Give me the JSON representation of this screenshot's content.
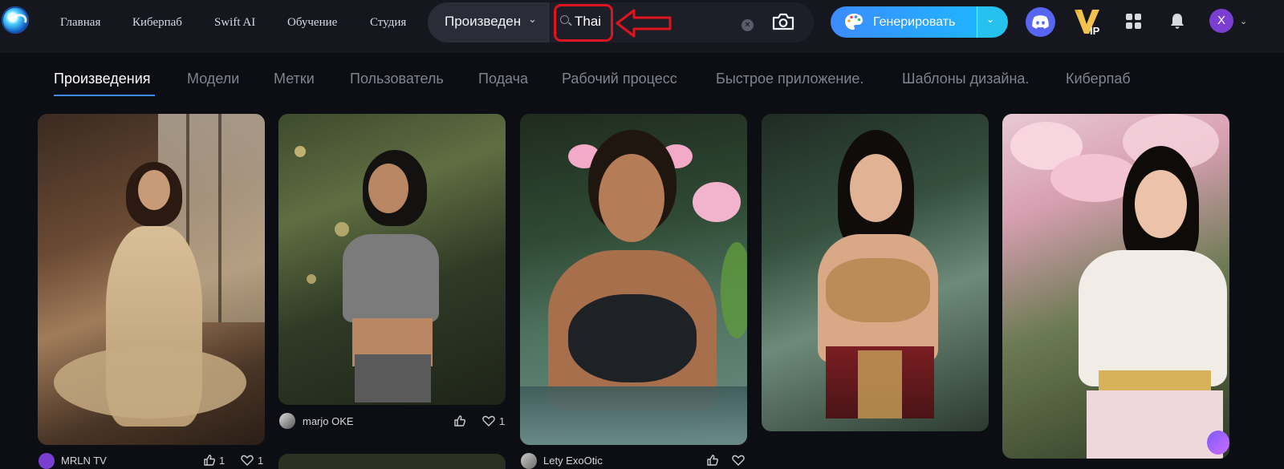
{
  "header": {
    "nav": [
      "Главная",
      "Киберпаб",
      "Swift AI",
      "Обучение",
      "Студия"
    ],
    "search": {
      "type_label": "Произведен",
      "value": "Thai"
    },
    "generate_label": "Генерировать",
    "avatar_letter": "X",
    "vip_label": "IP"
  },
  "tabs": [
    "Произведения",
    "Модели",
    "Метки",
    "Пользователь",
    "Подача",
    "Рабочий процесс",
    "Быстрое приложение.",
    "Шаблоны дизайна.",
    "Киберпаб"
  ],
  "gallery": [
    {
      "author": "MRLN TV",
      "likes": "1",
      "favorites": "1"
    },
    {
      "author": "marjo OKE",
      "likes": "",
      "favorites": "1"
    },
    {
      "author": "Lety ExoOtic",
      "likes": "",
      "favorites": ""
    },
    {
      "author": "",
      "likes": "",
      "favorites": ""
    },
    {
      "author": "",
      "likes": "",
      "favorites": ""
    }
  ],
  "colors": {
    "background": "#0d0e14",
    "topbar": "#15161e",
    "accent": "#3d8bff",
    "annotation": "#e0141e",
    "discord": "#5865f2",
    "avatar": "#7a3fd0"
  }
}
